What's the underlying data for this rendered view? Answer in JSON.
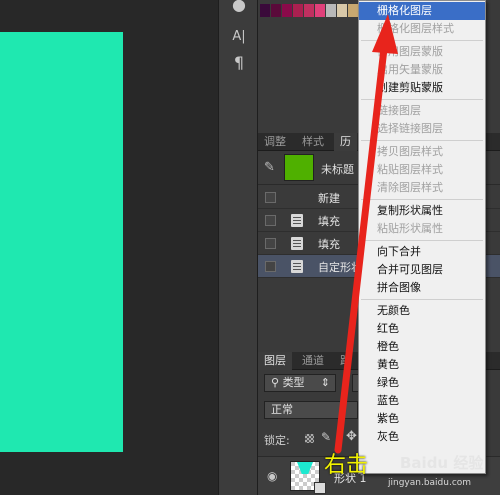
{
  "tools": {
    "type_vertical_icon": "A|",
    "paragraph_icon": "¶"
  },
  "swatch_colors": [
    "#3a0a3a",
    "#5a0a3a",
    "#8a0a4a",
    "#aa2050",
    "#c03060",
    "#e0407a",
    "#b8b8b8",
    "#d8c8a8",
    "#c8a870",
    "#a07840",
    "#705030",
    "#503020",
    "#b08868",
    "#907060"
  ],
  "panels": {
    "mid_tabs": [
      "调整",
      "样式",
      "历"
    ],
    "history": {
      "snapshot_title": "未标题",
      "items": [
        "新建",
        "填充",
        "填充",
        "自定形状"
      ]
    },
    "layer_tabs": [
      "图层",
      "通道",
      "路"
    ],
    "filter_label": "类型",
    "blend_mode": "正常",
    "lock_label": "锁定:",
    "layer_name": "形状 1"
  },
  "context_menu": {
    "items": [
      {
        "label": "栅格化图层",
        "state": "highlighted"
      },
      {
        "label": "栅格化图层样式",
        "state": "disabled"
      },
      {
        "label": "停用图层蒙版",
        "state": "disabled",
        "sep_before": true
      },
      {
        "label": "启用矢量蒙版",
        "state": "disabled"
      },
      {
        "label": "创建剪贴蒙版",
        "state": "enabled"
      },
      {
        "label": "链接图层",
        "state": "disabled",
        "sep_before": true
      },
      {
        "label": "选择链接图层",
        "state": "disabled"
      },
      {
        "label": "拷贝图层样式",
        "state": "disabled",
        "sep_before": true
      },
      {
        "label": "粘贴图层样式",
        "state": "disabled"
      },
      {
        "label": "清除图层样式",
        "state": "disabled"
      },
      {
        "label": "复制形状属性",
        "state": "enabled",
        "sep_before": true
      },
      {
        "label": "粘贴形状属性",
        "state": "disabled"
      },
      {
        "label": "向下合并",
        "state": "enabled",
        "sep_before": true
      },
      {
        "label": "合并可见图层",
        "state": "enabled"
      },
      {
        "label": "拼合图像",
        "state": "enabled"
      },
      {
        "label": "无颜色",
        "state": "enabled",
        "sep_before": true
      },
      {
        "label": "红色",
        "state": "enabled"
      },
      {
        "label": "橙色",
        "state": "enabled"
      },
      {
        "label": "黄色",
        "state": "enabled"
      },
      {
        "label": "绿色",
        "state": "enabled"
      },
      {
        "label": "蓝色",
        "state": "enabled"
      },
      {
        "label": "紫色",
        "state": "enabled"
      },
      {
        "label": "灰色",
        "state": "enabled"
      }
    ]
  },
  "annotation": {
    "text": "右击",
    "watermark": "jingyan.baidu.com",
    "brand": "Baidu 经验"
  },
  "colors": {
    "canvas_fill": "#1fe8b0",
    "highlight": "#3a6ec7",
    "arrow": "#e8241c",
    "annotation_text": "#f2f200"
  }
}
